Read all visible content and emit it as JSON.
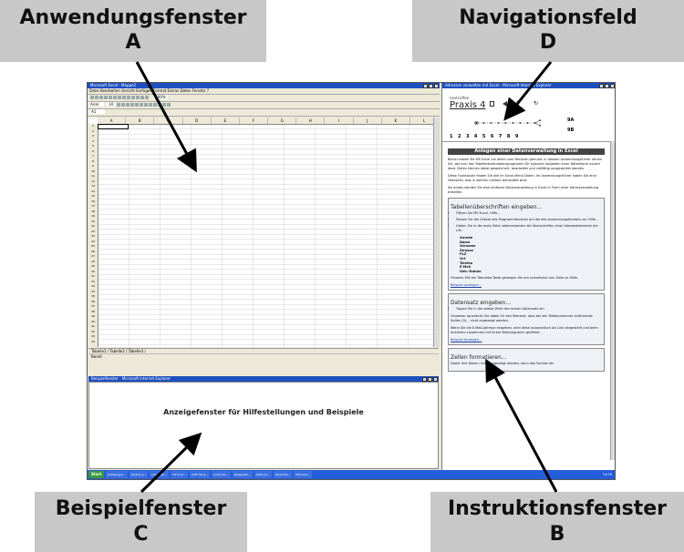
{
  "callouts": {
    "a": {
      "title": "Anwendungsfenster",
      "letter": "A"
    },
    "d": {
      "title": "Navigationsfeld",
      "letter": "D"
    },
    "c": {
      "title": "Beispielfenster",
      "letter": "C"
    },
    "b": {
      "title": "Instruktionsfenster",
      "letter": "B"
    }
  },
  "excel": {
    "title": "Microsoft Excel - Mappe2",
    "menu": "Datei  Bearbeiten  Ansicht  Einfügen  Format  Extras  Daten  Fenster  ?",
    "font": "Arial",
    "size": "10",
    "zoom": "100%",
    "namebox": "A1",
    "columns": [
      "A",
      "B",
      "C",
      "D",
      "E",
      "F",
      "G",
      "H",
      "I",
      "J",
      "K",
      "L"
    ],
    "sheet_tabs": "Tabelle1 / Tabelle2 / Tabelle3 /",
    "status": "Bereit"
  },
  "example": {
    "title": "Beispielfenster - Microsoft Internet Explorer",
    "message": "Anzeigefenster für Hilfestellungen und Beispiele"
  },
  "nav": {
    "title": "Adressen verwalten mit Excel - Microsoft Internet Explorer",
    "brand_small": "nextcoffee",
    "brand": "Praxis 4",
    "numbers": "123456789",
    "extra_a": "9A",
    "extra_b": "9B"
  },
  "instructions": {
    "heading": "Anlegen einer Datenverwaltung in Excel",
    "p1": "Bisher haben Sie MS Excel vor allem zum Rechnen genutzt. In diesem Anwendungsführer lernen Sie, wie sich das Tabellenkalkulationsprogramm für typische Aufgaben einer Datenbank nutzen lässt. Daten können dabei gespeichert, bearbeitet und vielfältig ausgewertet werden.",
    "p2": "Diese Funktionen finden Sie alle im Excel-Menü Daten. Im Anwendungsführer haben Sie eine Übersicht, was in welcher Lektion behandelt wird.",
    "p3": "Als erstes werden Sie eine einfache Datenverwaltung in Excel in Form einer Adressverwaltung erstellen.",
    "h_tab": "Tabellenüberschriften eingeben...",
    "li1": "Öffnen Sie MS Excel. Hilfe...",
    "li2": "Passen Sie die Grösse des Programmfensters auf die des Anwendungsfensters an. Hilfe...",
    "li3": "Geben Sie in die erste Zeile nebeneinander die Überschriften einer Adressdatenbank ein: z.B.:",
    "fields": [
      "Anrede",
      "Name",
      "Vorname",
      "Strasse",
      "PLZ",
      "Ort",
      "Telefon",
      "E-Mail",
      "Geb.-Datum"
    ],
    "hint1": "Hinweis: Mit der Tabulator-Taste gelangen Sie am schnellsten von Zelle zu Zelle.",
    "example_link": "Beispiel anzeigen...",
    "h_data": "Datensatz eingeben...",
    "li4": "Tippen Sie in die zweite Zeile den ersten Datensatz ein.",
    "hint2": "Hinweise: Ignorieren Sie dabei für den Moment, dass bei der Telefonnummer anführende Nullen (0)... nicht angezeigt werden.",
    "p4": "Wenn Sie die E-Mail-Adresse eingeben, wird diese automatisch als Link dargestellt und beim Anklicken zusammen mit Ihrem Mailprogramm geöffnet.",
    "example_link2": "Beispiel Anzeigen...",
    "h_cells": "Zellen formatieren...",
    "p5": "Damit Ihre Daten richtig angezeigt werden, kann das Format der"
  },
  "taskbar": {
    "start": "Start",
    "tasks": [
      "Postemgeo...",
      "Kursinf_p...",
      "Informati...",
      "TR Cont...",
      "VOM Haus...",
      "Index Hin...",
      "Beispielfe...",
      "Datei ve...",
      "Excel-Pla...",
      "Microsof..."
    ],
    "clock": "14:09"
  },
  "colors": {
    "callout_bg": "#c8c8c8",
    "titlebar": "#1d4fbf",
    "taskbar": "#245edb"
  }
}
